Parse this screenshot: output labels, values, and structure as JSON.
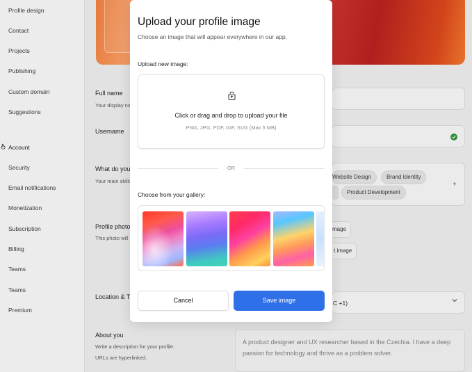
{
  "sidebar": {
    "items_top": [
      "Profile design",
      "Contact",
      "Projects",
      "Publishing",
      "Custom domain",
      "Suggestions"
    ],
    "section_label": "Account",
    "items_bottom": [
      "Security",
      "Email notifications",
      "Monetization",
      "Subscription",
      "Billing",
      "Teams",
      "Teams",
      "Premium"
    ]
  },
  "background": {
    "full_name": {
      "label": "Full name",
      "sub": "Your display nar"
    },
    "username": {
      "label": "Username"
    },
    "what_do_you": {
      "label": "What do you d",
      "sub": "Your main skills"
    },
    "skills": [
      "Website Design",
      "Brand Identity",
      "Product Development"
    ],
    "plus": "+",
    "profile_photo": {
      "label": "Profile photo",
      "sub": "This photo will b"
    },
    "photo_buttons": [
      "mage",
      "t image"
    ],
    "location": {
      "label": "Location & Tir",
      "value": "C +1)"
    },
    "about": {
      "label": "About you",
      "sub1": "Write a description for your profile.",
      "sub2": "URLs are hyperlinked.",
      "text": "A product designer and UX researcher based in the Czechia. I have a deep passion for technology and thrive as a problem solver."
    }
  },
  "modal": {
    "title": "Upload your profile image",
    "subtitle": "Choose an image that will appear everywhere in our app.",
    "upload_label": "Upload new image:",
    "dropzone_text": "Click or drag and drop to upload your file",
    "dropzone_hint": "PNG, JPG, PDF, GIF, SVG (Max 5 MB)",
    "or_text": "OR",
    "gallery_label": "Choose from your gallery:",
    "cancel_label": "Cancel",
    "save_label": "Save image"
  }
}
